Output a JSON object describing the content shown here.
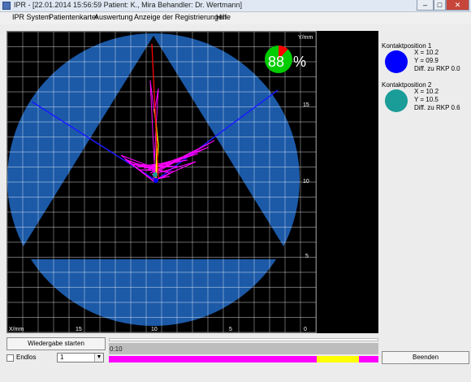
{
  "window": {
    "title": "IPR - [22.01.2014 15:56:59 Patient: K., Mira  Behandler: Dr. Wertmann]",
    "minimize": "–",
    "maximize": "□",
    "close": "✕"
  },
  "menu": [
    "IPR System",
    "Patientenkartei",
    "Auswertung",
    "Anzeige der Registrierungen",
    "Hilfe"
  ],
  "plot": {
    "y_axis_label": "Y/mm",
    "x_axis_label": "X/mm",
    "y_ticks": [
      "15",
      "10",
      "5"
    ],
    "x_ticks": [
      "15",
      "10",
      "5",
      "0"
    ],
    "percent": "88",
    "percent_sign": "%",
    "pie_fraction_green": 0.88,
    "colors": {
      "background": "#000000",
      "circle": "#1c5aa8",
      "grid": "#ffffff",
      "lines": "#1a1aff",
      "trace_magenta": "#ff00ff",
      "trace_yellow": "#ffff00",
      "trace_red": "#ff0000",
      "pie_green": "#00cc00",
      "pie_red": "#ff0000"
    }
  },
  "contacts": [
    {
      "title": "Kontaktposition 1",
      "x": "X = 10.2",
      "y": "Y = 09.9",
      "diff": "Diff. zu RKP  0.0",
      "color": "#0000ff"
    },
    {
      "title": "Kontaktposition 2",
      "x": "X = 10.2",
      "y": "Y = 10.5",
      "diff": "Diff. zu RKP  0.6",
      "color": "#1a9c98"
    }
  ],
  "controls": {
    "play_button": "Wiedergabe starten",
    "loop_label": "Endlos",
    "loop_checked": false,
    "loop_count": "1",
    "time": "0:10",
    "end_button": "Beenden"
  },
  "timeline": {
    "magenta": "#ff00ff",
    "yellow": "#ffff00",
    "gray": "#a0a0a0"
  }
}
